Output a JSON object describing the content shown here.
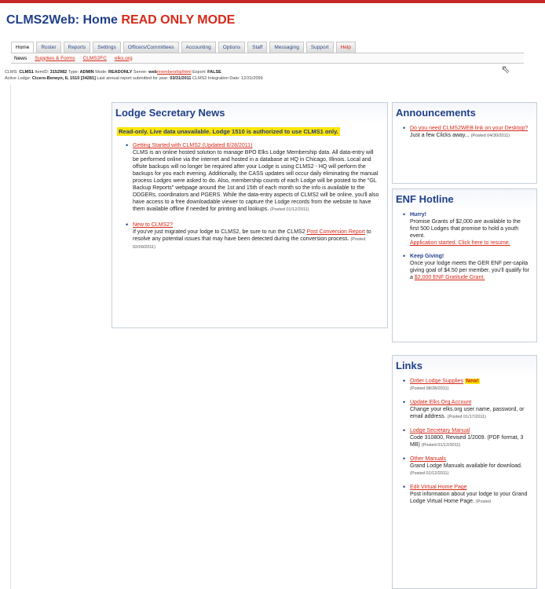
{
  "page": {
    "title_prefix": "CLMS2Web: Home",
    "title_mode": "READ ONLY MODE"
  },
  "tabs": [
    {
      "label": "Home"
    },
    {
      "label": "Roster"
    },
    {
      "label": "Reports"
    },
    {
      "label": "Settings"
    },
    {
      "label": "Officers/Committees"
    },
    {
      "label": "Accounting"
    },
    {
      "label": "Options"
    },
    {
      "label": "Staff"
    },
    {
      "label": "Messaging"
    },
    {
      "label": "Support"
    },
    {
      "label": "Help"
    }
  ],
  "sub_tabs": {
    "current": "News",
    "links": [
      "Supplies & Forms",
      "CLMS2FC",
      "elks.org"
    ]
  },
  "info": {
    "line1": {
      "clms_label": "CLMS:",
      "clms_value": "CLMS1",
      "itemid_label": "ItemID:",
      "itemid_value": "3152982",
      "type_label": "Type:",
      "type_value": "ADMIN",
      "mode_label": "Mode:",
      "mode_value": "READONLY",
      "server_label": "Server:",
      "server_value": "web",
      "server_link": "/membership/html",
      "export_label": "Export:",
      "export_value": "FALSE"
    },
    "line2": {
      "lodge_label": "Active Lodge:",
      "lodge_value": "Cicero-Berwyn, IL 1510 [34281]",
      "report_label": "Last annual report submitted for year:",
      "report_value": "03/31/2011",
      "integration_label": "CLMS2 Integration Date:",
      "integration_value": "12/31/2099"
    }
  },
  "news": {
    "title": "Lodge Secretary News",
    "readonly_notice": "Read-only. Live data unavailable. Lodge 1510 is authorized to use CLMS1 only.",
    "items": [
      {
        "link": "Getting Started with CLMS2 (Updated 6/28/2011)",
        "text": "CLMS is an online hosted solution to manage BPO Elks Lodge Membership data. All data-entry will be performed online via the internet and hosted in a database at HQ in Chicago, Illinois. Local and offsite backups will no longer be required after your Lodge is using CLMS2 - HQ will perform the backups for you each evening. Additionally, the CASS updates will occur daily eliminating the manual process Lodges were asked to do. Also, membership counts of each Lodge will be posted to the \"GL Backup Reports\" webpage around the 1st and 15th of each month so the info is available to the DDGERs, coordinators and PGERS. While the data-entry aspects of CLMS2 will be online, you'll also have access to a free downloadable viewer to capture the Lodge records from the website to have them available offline if needed for printing and lookups.",
        "posted": "(Posted 01/12/2011)"
      },
      {
        "link": "New to CLMS2?",
        "text_before": "If you've just migrated your lodge to CLMS2, be sure to run the CLMS2",
        "text_link": "Post Conversion Report",
        "text_after": "to resolve any potential issues that may have been detected during the conversion process.",
        "posted": "(Posted 02/09/2011)"
      }
    ]
  },
  "announcements": {
    "title": "Announcements",
    "items": [
      {
        "link": "Do you need CLMS2WEB link on your Desktop?",
        "text": "Just a few Clicks away...",
        "posted": "(Posted 04/30/2011)"
      }
    ]
  },
  "enf": {
    "title": "ENF Hotline",
    "items": [
      {
        "heading": "Hurry!",
        "text": "Promise Grants of $2,000 are available to the first 500 Lodges that promise to hold a youth event.",
        "link": "Application started. Click here to resume."
      },
      {
        "heading": "Keep Giving!",
        "text": "Once your lodge meets the GER ENF per-capita giving goal of $4.50 per member, you'll qualify for a",
        "link": "$2,000 ENF Gratitude Grant."
      }
    ]
  },
  "links": {
    "title": "Links",
    "items": [
      {
        "link": "Order Lodge Supplies",
        "badge": "New!",
        "text": "",
        "posted": "(Posted 08/28/2011)"
      },
      {
        "link": "Update Elks.Org Account",
        "text": "Change your elks.org user name, password, or email address.",
        "posted": "(Posted 01/17/2011)"
      },
      {
        "link": "Lodge Secretary Manual",
        "text": "Code 310800, Revised 1/2009. (PDF format, 3 MB)",
        "posted": "(Posted 01/12/2011)"
      },
      {
        "link": "Other Manuals",
        "text": "Grand Lodge Manuals available for download.",
        "posted": "(Posted 01/12/2011)"
      },
      {
        "link": "Edit Virtual Home Page",
        "text": "Post information about your lodge to your Grand Lodge Virtual Home Page.",
        "posted": "(Posted"
      }
    ]
  }
}
